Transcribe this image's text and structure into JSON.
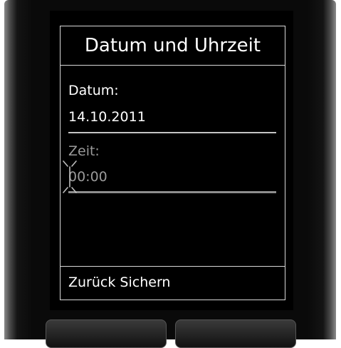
{
  "screen": {
    "title": "Datum und Uhrzeit",
    "date_field": {
      "label": "Datum:",
      "value": "14.10.2011"
    },
    "time_field": {
      "label": "Zeit:",
      "value": "00:00"
    },
    "softkeys": {
      "back": "Zurück",
      "save": "Sichern"
    }
  },
  "colors": {
    "screen_background": "#000000",
    "text": "#ffffff",
    "inactive_text": "#9a9a9a",
    "frame_border": "#d8d8d8"
  },
  "icons": {
    "cursor": "blinking-cursor-icon"
  }
}
